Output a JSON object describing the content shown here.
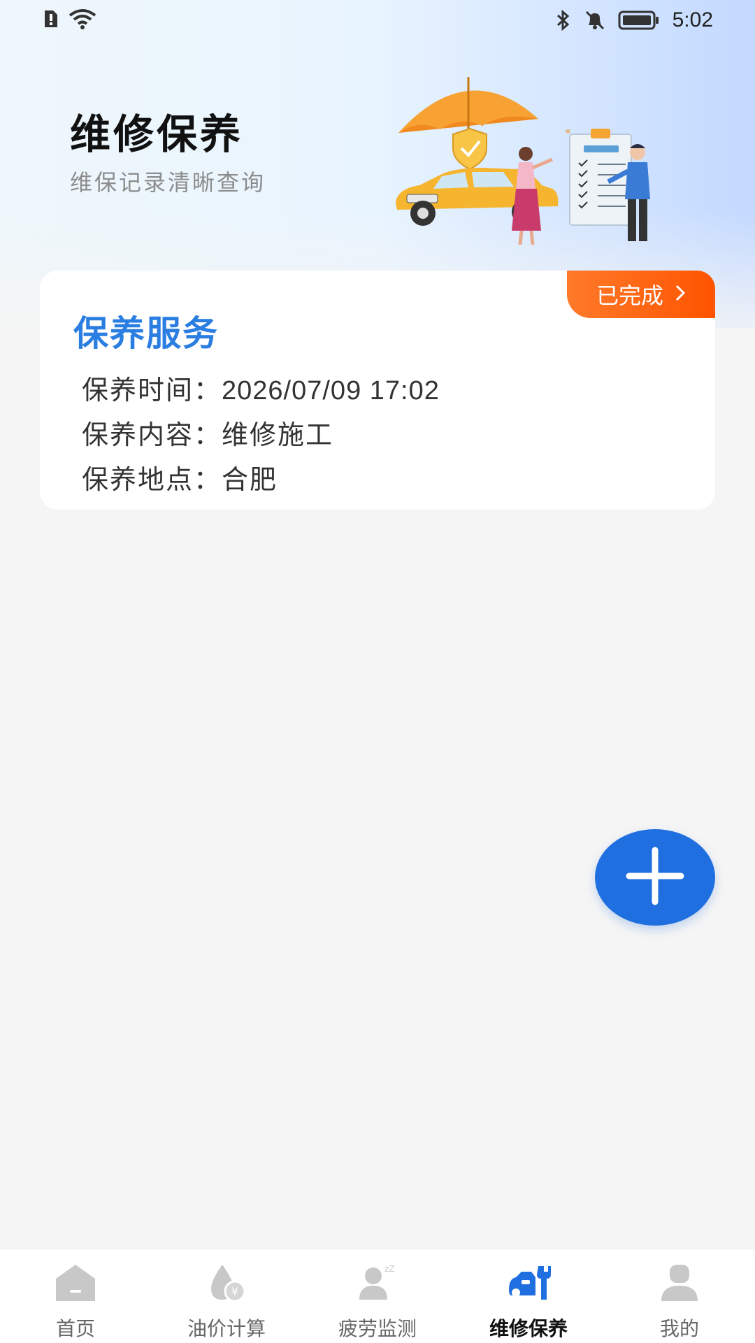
{
  "status_bar": {
    "time": "5:02",
    "icons_left": [
      "alert-sim-icon",
      "wifi-icon"
    ],
    "icons_right": [
      "bluetooth-icon",
      "bell-muted-icon",
      "battery-icon"
    ]
  },
  "hero": {
    "title": "维修保养",
    "subtitle": "维保记录清晰查询",
    "illustration": "car-umbrella-service-illustration"
  },
  "record": {
    "title": "保养服务",
    "status": "已完成",
    "rows": [
      {
        "label": "保养时间：",
        "value": "2026/07/09 17:02"
      },
      {
        "label": "保养内容：",
        "value": "维修施工"
      },
      {
        "label": "保养地点：",
        "value": "合肥"
      }
    ]
  },
  "fab": {
    "icon": "plus-icon"
  },
  "tabbar": {
    "active_index": 3,
    "active_color": "#1f6fe0",
    "inactive_color": "#c8c8c8",
    "tabs": [
      {
        "label": "首页",
        "icon": "home-icon"
      },
      {
        "label": "油价计算",
        "icon": "fuel-price-icon"
      },
      {
        "label": "疲劳监测",
        "icon": "fatigue-monitor-icon"
      },
      {
        "label": "维修保养",
        "icon": "car-repair-icon"
      },
      {
        "label": "我的",
        "icon": "profile-icon"
      }
    ]
  },
  "colors": {
    "accent": "#2a7de1",
    "badge": "#ff6a13",
    "fab": "#1f6fe0"
  }
}
